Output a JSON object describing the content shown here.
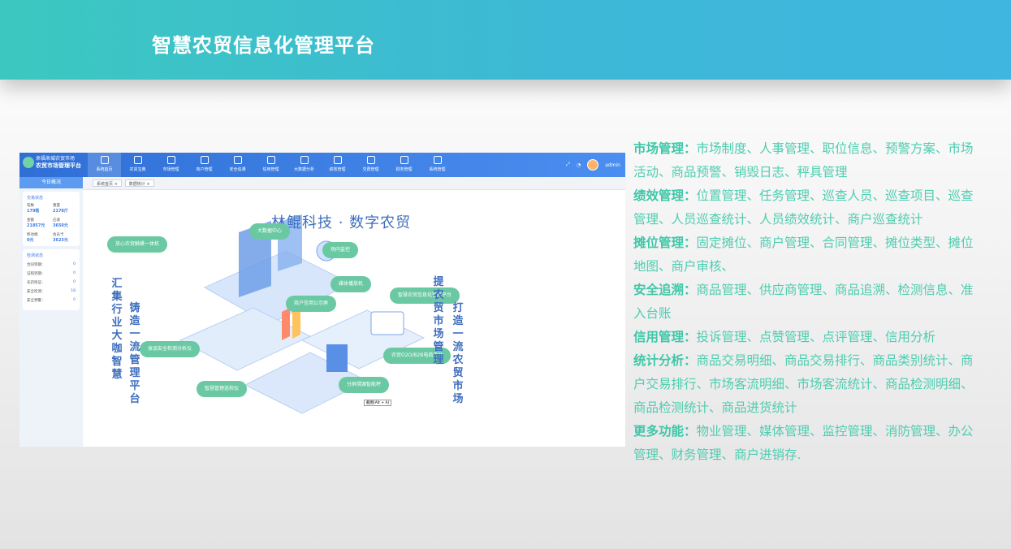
{
  "banner": {
    "title": "智慧农贸信息化管理平台"
  },
  "screenshot": {
    "brand_line1": "来福来城农贸市场",
    "brand_line2": "农贸市场管理平台",
    "nav": [
      "系统首页",
      "农贸宝典",
      "市场管理",
      "商户管理",
      "安全追溯",
      "信用管理",
      "大数据分析",
      "绩效管理",
      "交费管理",
      "财务管理",
      "系统管理"
    ],
    "user": "admin",
    "side_head": "今日概况",
    "card1_title": "交易状态",
    "stats": [
      {
        "label": "笔数",
        "value": "179笔"
      },
      {
        "label": "重量",
        "value": "2178斤"
      },
      {
        "label": "金额",
        "value": "21857元"
      },
      {
        "label": "应收",
        "value": "3650元"
      },
      {
        "label": "移动端",
        "value": "0元"
      },
      {
        "label": "会员卡",
        "value": "3623元"
      }
    ],
    "card2_title": "检测状态",
    "checks": [
      {
        "label": "合同到期：",
        "value": "0"
      },
      {
        "label": "证照到期：",
        "value": "0"
      },
      {
        "label": "农药残证：",
        "value": "0"
      },
      {
        "label": "安全检测：",
        "value": "18"
      },
      {
        "label": "安全预警：",
        "value": "0"
      }
    ],
    "tabs": [
      "系统首页 ×",
      "数据统计 ×"
    ],
    "hero_title": "林鲲科技 · 数字农贸",
    "pills": [
      "放心农贸触摸一体机",
      "大数据中心",
      "场内监控",
      "媒体播放机",
      "智慧农贸信息化管理平台",
      "商户信用公示屏",
      "食品安全检测分析仪",
      "农贸O2O/B2B电商平台",
      "智慧管理巡检仪",
      "分屏溯源智能秤"
    ],
    "left_v1": "汇集行业大咖智慧",
    "left_v2": "铸造一流管理平台",
    "right_v1": "提农贸市场管理",
    "right_v2": "打造一流农贸市场",
    "small_tag": "截图(Alt + A)"
  },
  "features": [
    {
      "label": "市场管理：",
      "text": "市场制度、人事管理、职位信息、预警方案、市场活动、商品预警、销毁日志、秤具管理"
    },
    {
      "label": "绩效管理：",
      "text": "位置管理、任务管理、巡查人员、巡查项目、巡查管理、人员巡查统计、人员绩效统计、商户巡查统计"
    },
    {
      "label": "摊位管理：",
      "text": "固定摊位、商户管理、合同管理、摊位类型、摊位地图、商户审核、"
    },
    {
      "label": "安全追溯：",
      "text": "商品管理、供应商管理、商品追溯、检测信息、准入台账"
    },
    {
      "label": "信用管理：",
      "text": "投诉管理、点赞管理、点评管理、信用分析"
    },
    {
      "label": "统计分析：",
      "text": "商品交易明细、商品交易排行、商品类别统计、商户交易排行、市场客流明细、市场客流统计、商品检测明细、商品检测统计、商品进货统计"
    },
    {
      "label": "更多功能：",
      "text": "物业管理、媒体管理、监控管理、消防管理、办公管理、财务管理、商户进销存."
    }
  ]
}
